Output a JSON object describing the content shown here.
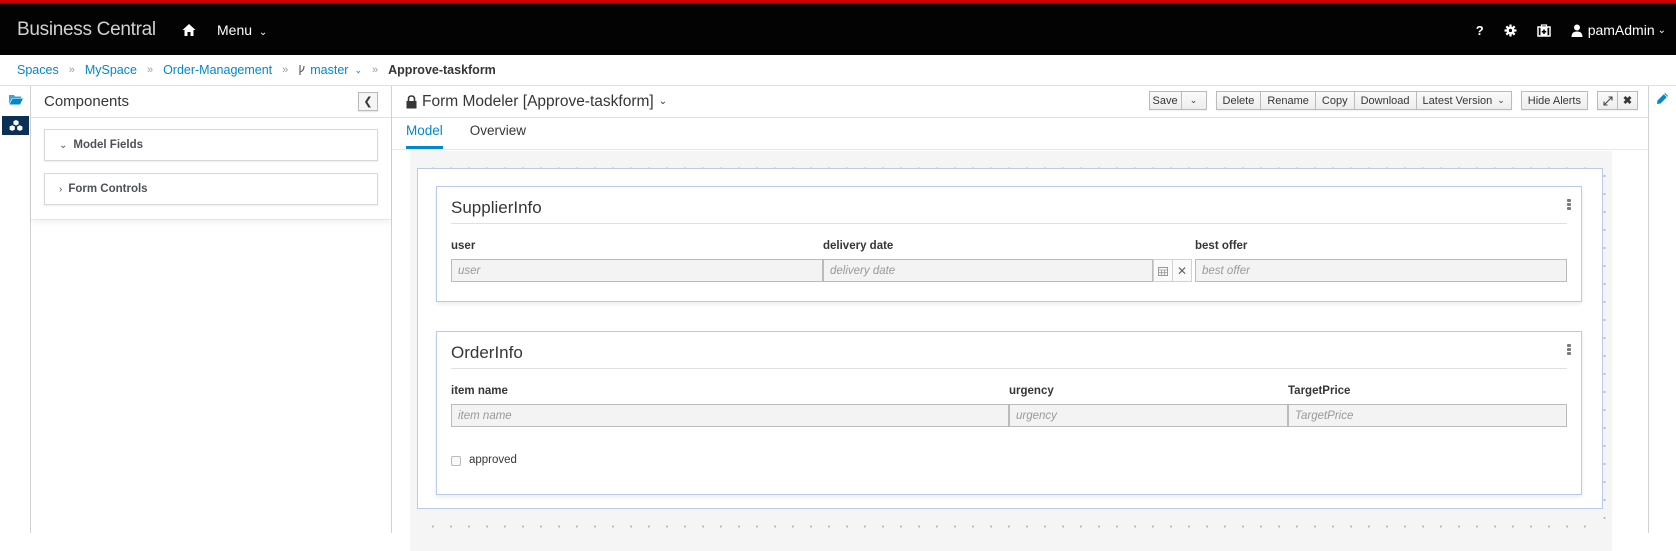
{
  "app": {
    "brand": "Business Central",
    "menu_label": "Menu",
    "help_label": "?",
    "user_label": "pamAdmin",
    "accent_color": "#0088ce",
    "topbar_stripe_color": "#cc0000"
  },
  "breadcrumb": {
    "items": [
      "Spaces",
      "MySpace",
      "Order-Management"
    ],
    "branch": "master",
    "current": "Approve-taskform"
  },
  "components": {
    "title": "Components",
    "panels": [
      {
        "label": "Model Fields",
        "expanded": true
      },
      {
        "label": "Form Controls",
        "expanded": false
      }
    ]
  },
  "editor": {
    "title": "Form Modeler [Approve-taskform]",
    "toolbar": {
      "save": "Save",
      "delete": "Delete",
      "rename": "Rename",
      "copy": "Copy",
      "download": "Download",
      "latest_version": "Latest Version",
      "hide_alerts": "Hide Alerts"
    },
    "tabs": [
      {
        "label": "Model",
        "active": true
      },
      {
        "label": "Overview",
        "active": false
      }
    ]
  },
  "form": {
    "groups": [
      {
        "title": "SupplierInfo",
        "fields": [
          {
            "label": "user",
            "placeholder": "user"
          },
          {
            "label": "delivery date",
            "placeholder": "delivery date"
          },
          {
            "label": "best offer",
            "placeholder": "best offer"
          }
        ]
      },
      {
        "title": "OrderInfo",
        "fields": [
          {
            "label": "item name",
            "placeholder": "item name"
          },
          {
            "label": "urgency",
            "placeholder": "urgency"
          },
          {
            "label": "TargetPrice",
            "placeholder": "TargetPrice"
          }
        ],
        "checkbox": {
          "label": "approved",
          "checked": false
        }
      }
    ]
  }
}
